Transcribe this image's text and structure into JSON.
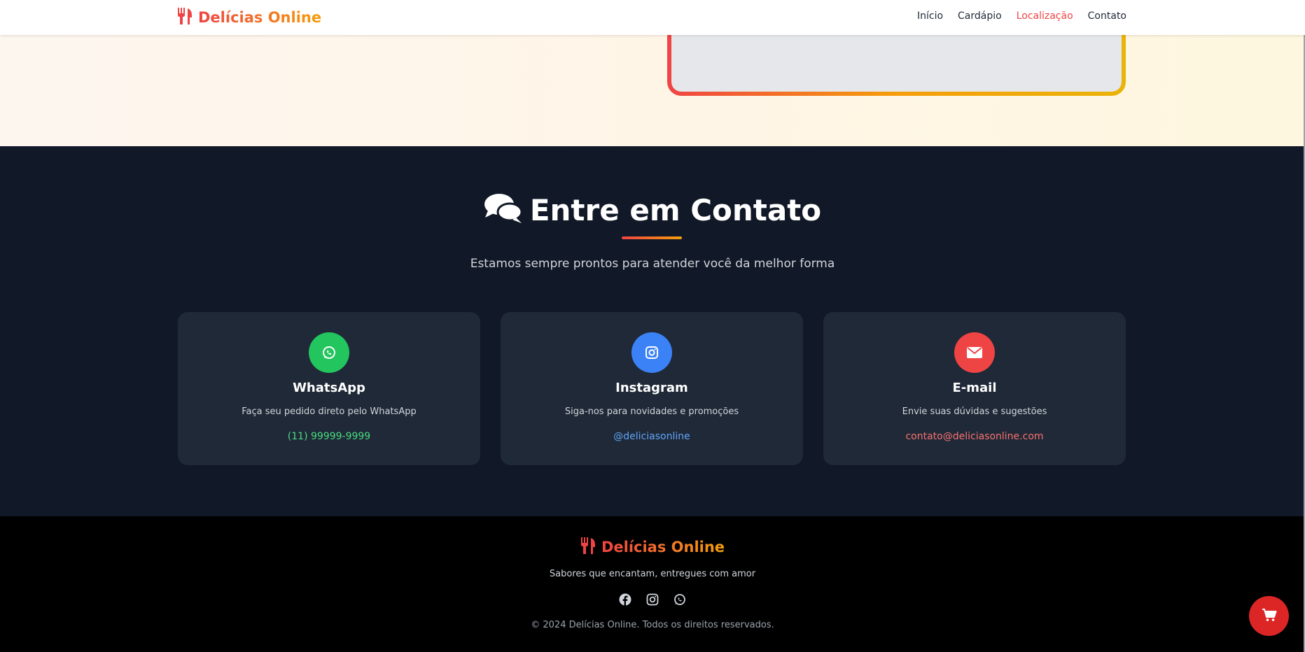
{
  "header": {
    "brand": "Delícias Online",
    "nav": [
      {
        "label": "Início",
        "active": false
      },
      {
        "label": "Cardápio",
        "active": false
      },
      {
        "label": "Localização",
        "active": true
      },
      {
        "label": "Contato",
        "active": false
      }
    ]
  },
  "contact": {
    "title": "Entre em Contato",
    "title_icon": "comments-icon",
    "subtitle": "Estamos sempre prontos para atender você da melhor forma",
    "cards": [
      {
        "icon": "whatsapp-icon",
        "title": "WhatsApp",
        "description": "Faça seu pedido direto pelo WhatsApp",
        "link": "(11) 99999-9999",
        "color": "#22c55e",
        "link_color": "#4ade80"
      },
      {
        "icon": "instagram-icon",
        "title": "Instagram",
        "description": "Siga-nos para novidades e promoções",
        "link": "@deliciasonline",
        "color": "#3b82f6",
        "link_color": "#60a5fa"
      },
      {
        "icon": "envelope-icon",
        "title": "E-mail",
        "description": "Envie suas dúvidas e sugestões",
        "link": "contato@deliciasonline.com",
        "color": "#ef4444",
        "link_color": "#f87171"
      }
    ]
  },
  "footer": {
    "brand": "Delícias Online",
    "tagline": "Sabores que encantam, entregues com amor",
    "social": [
      "facebook-icon",
      "instagram-icon",
      "whatsapp-icon"
    ],
    "copyright": "© 2024 Delícias Online. Todos os direitos reservados."
  },
  "cart": {
    "icon": "shopping-cart-icon"
  },
  "colors": {
    "accent_red": "#ef4444",
    "accent_orange": "#f59e0b",
    "dark_bg": "#111827",
    "card_bg": "#1f2937"
  }
}
